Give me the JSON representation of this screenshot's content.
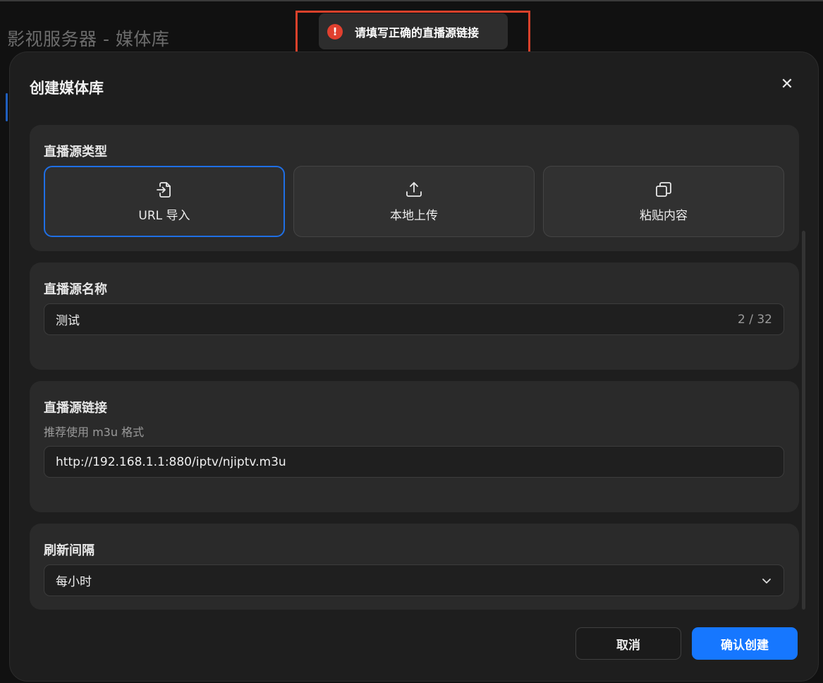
{
  "background": {
    "title": "影视服务器 - 媒体库"
  },
  "toast": {
    "icon": "error-icon",
    "icon_glyph": "!",
    "message": "请填写正确的直播源链接",
    "color": "#e0402f"
  },
  "modal": {
    "title": "创建媒体库",
    "close_glyph": "✕",
    "source_type": {
      "label": "直播源类型",
      "options": [
        {
          "label": "URL 导入",
          "icon": "import-icon",
          "selected": true
        },
        {
          "label": "本地上传",
          "icon": "upload-icon",
          "selected": false
        },
        {
          "label": "粘贴内容",
          "icon": "copy-icon",
          "selected": false
        }
      ]
    },
    "source_name": {
      "label": "直播源名称",
      "value": "测试",
      "counter": "2 / 32"
    },
    "source_link": {
      "label": "直播源链接",
      "hint": "推荐使用 m3u 格式",
      "value": "http://192.168.1.1:880/iptv/njiptv.m3u"
    },
    "refresh_interval": {
      "label": "刷新间隔",
      "value": "每小时"
    },
    "buttons": {
      "cancel": "取消",
      "confirm": "确认创建"
    }
  },
  "colors": {
    "accent": "#1677ff",
    "error": "#e0402f",
    "highlight_box": "#d9412b"
  }
}
